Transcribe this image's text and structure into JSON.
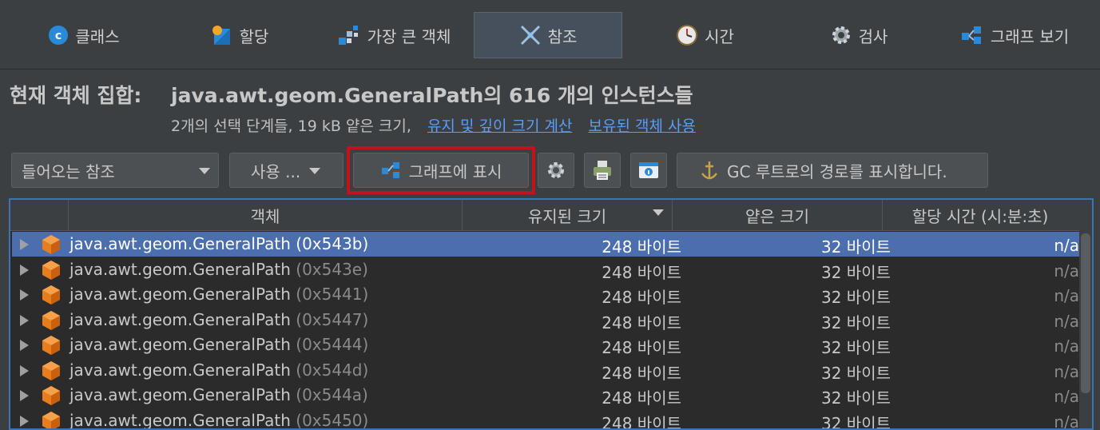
{
  "tabs": [
    {
      "label": "클래스",
      "icon": "class-icon",
      "active": false
    },
    {
      "label": "할당",
      "icon": "allocation-icon",
      "active": false
    },
    {
      "label": "가장 큰 객체",
      "icon": "biggest-objects-icon",
      "active": false
    },
    {
      "label": "참조",
      "icon": "references-icon",
      "active": true
    },
    {
      "label": "시간",
      "icon": "time-icon",
      "active": false
    },
    {
      "label": "검사",
      "icon": "inspection-icon",
      "active": false
    },
    {
      "label": "그래프 보기",
      "icon": "graph-icon",
      "active": false
    }
  ],
  "header": {
    "label": "현재 객체 집합:",
    "value": "java.awt.geom.GeneralPath의 616 개의 인스턴스들",
    "summary": "2개의 선택 단계들, 19 kB 얕은 크기,",
    "link_retained": "유지 및 깊이 크기 계산",
    "link_use": "보유된 객체 사용"
  },
  "toolbar": {
    "reference_combo": "들어오는 참조",
    "use_dropdown": "사용 ...",
    "show_graph": "그래프에 표시",
    "gc_root": "GC 루트로의 경로를 표시합니다."
  },
  "table": {
    "columns": [
      "객체",
      "유지된 크기",
      "얕은 크기",
      "할당 시간 (시:분:초)"
    ],
    "sorted_column": "유지된 크기",
    "rows": [
      {
        "class": "java.awt.geom.GeneralPath",
        "addr": "(0x543b)",
        "retained": "248 바이트",
        "shallow": "32 바이트",
        "time": "n/a",
        "selected": true
      },
      {
        "class": "java.awt.geom.GeneralPath",
        "addr": "(0x543e)",
        "retained": "248 바이트",
        "shallow": "32 바이트",
        "time": "n/a",
        "selected": false
      },
      {
        "class": "java.awt.geom.GeneralPath",
        "addr": "(0x5441)",
        "retained": "248 바이트",
        "shallow": "32 바이트",
        "time": "n/a",
        "selected": false
      },
      {
        "class": "java.awt.geom.GeneralPath",
        "addr": "(0x5447)",
        "retained": "248 바이트",
        "shallow": "32 바이트",
        "time": "n/a",
        "selected": false
      },
      {
        "class": "java.awt.geom.GeneralPath",
        "addr": "(0x5444)",
        "retained": "248 바이트",
        "shallow": "32 바이트",
        "time": "n/a",
        "selected": false
      },
      {
        "class": "java.awt.geom.GeneralPath",
        "addr": "(0x544d)",
        "retained": "248 바이트",
        "shallow": "32 바이트",
        "time": "n/a",
        "selected": false
      },
      {
        "class": "java.awt.geom.GeneralPath",
        "addr": "(0x544a)",
        "retained": "248 바이트",
        "shallow": "32 바이트",
        "time": "n/a",
        "selected": false
      },
      {
        "class": "java.awt.geom.GeneralPath",
        "addr": "(0x5450)",
        "retained": "248 바이트",
        "shallow": "32 바이트",
        "time": "n/a",
        "selected": false
      }
    ]
  },
  "colors": {
    "selection": "#4b6eaf",
    "link": "#589df6",
    "highlight": "#c0141a",
    "cube": "#e87d1e"
  }
}
